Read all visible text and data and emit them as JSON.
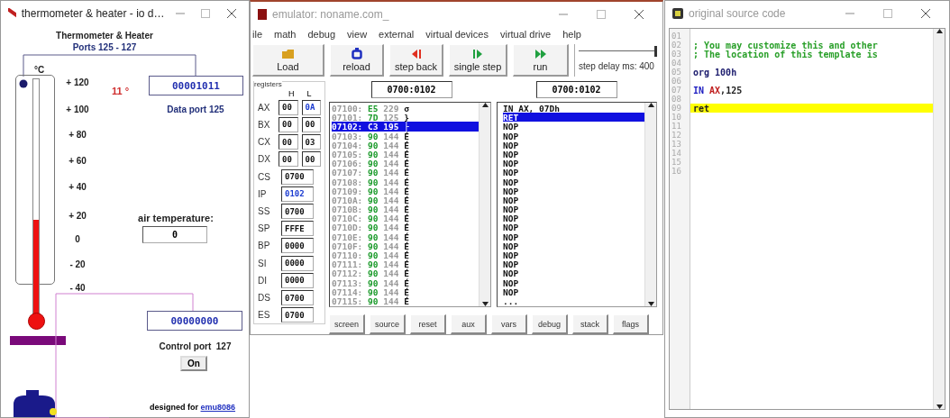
{
  "device": {
    "title": "thermometer & heater - io d…",
    "heading": "Thermometer & Heater",
    "ports": "Ports 125 - 127",
    "unit": "°C",
    "scale": [
      "+ 120",
      "+ 100",
      "+ 80",
      "+ 60",
      "+ 40",
      "+ 20",
      "0",
      "- 20",
      "- 40"
    ],
    "temperature": {
      "reading": "11 °",
      "level": 0.4
    },
    "data_port": {
      "value": "00001011",
      "label": "Data port 125"
    },
    "air": {
      "label": "air temperature:",
      "value": "0"
    },
    "control_port": {
      "value": "00000000",
      "label": "Control port  127"
    },
    "on_button": "On",
    "footer": "designed for",
    "footer_link": "emu8086"
  },
  "emulator": {
    "title": "emulator: noname.com_",
    "menu": [
      "ile",
      "math",
      "debug",
      "view",
      "external",
      "virtual devices",
      "virtual drive",
      "help"
    ],
    "toolbar": [
      {
        "label": "Load",
        "kind": "load"
      },
      {
        "label": "reload",
        "kind": "reload"
      },
      {
        "label": "step back",
        "kind": "back"
      },
      {
        "label": "single step",
        "kind": "step"
      },
      {
        "label": "run",
        "kind": "run"
      }
    ],
    "delay": {
      "label": "step delay ms: 400",
      "level": 1
    },
    "registers": {
      "title": "registers",
      "high": "H",
      "low": "L",
      "pairs": [
        {
          "name": "AX",
          "high": {
            "value": "00",
            "changed": false
          },
          "low": {
            "value": "0A",
            "changed": true
          }
        },
        {
          "name": "BX",
          "high": {
            "value": "00",
            "changed": false
          },
          "low": {
            "value": "00",
            "changed": false
          }
        },
        {
          "name": "CX",
          "high": {
            "value": "00",
            "changed": false
          },
          "low": {
            "value": "03",
            "changed": false
          }
        },
        {
          "name": "DX",
          "high": {
            "value": "00",
            "changed": false
          },
          "low": {
            "value": "00",
            "changed": false
          }
        }
      ],
      "segments": [
        {
          "name": "CS",
          "value": "0700",
          "changed": false
        },
        {
          "name": "IP",
          "value": "0102",
          "changed": true
        },
        {
          "name": "SS",
          "value": "0700",
          "changed": false
        },
        {
          "name": "SP",
          "value": "FFFE",
          "changed": false
        },
        {
          "name": "BP",
          "value": "0000",
          "changed": false
        },
        {
          "name": "SI",
          "value": "0000",
          "changed": false
        },
        {
          "name": "DI",
          "value": "0000",
          "changed": false
        },
        {
          "name": "DS",
          "value": "0700",
          "changed": false
        },
        {
          "name": "ES",
          "value": "0700",
          "changed": false
        }
      ]
    },
    "memory_address": "0700:0102",
    "disasm_address": "0700:0102",
    "memory": [
      {
        "addr": "07100:",
        "hex": "E5",
        "dec": "229",
        "char": "σ",
        "selected": false
      },
      {
        "addr": "07101:",
        "hex": "7D",
        "dec": "125",
        "char": "}",
        "selected": false
      },
      {
        "addr": "07102:",
        "hex": "C3",
        "dec": "195",
        "char": "├",
        "selected": true
      },
      {
        "addr": "07103:",
        "hex": "90",
        "dec": "144",
        "char": "É",
        "selected": false
      },
      {
        "addr": "07104:",
        "hex": "90",
        "dec": "144",
        "char": "É",
        "selected": false
      },
      {
        "addr": "07105:",
        "hex": "90",
        "dec": "144",
        "char": "É",
        "selected": false
      },
      {
        "addr": "07106:",
        "hex": "90",
        "dec": "144",
        "char": "É",
        "selected": false
      },
      {
        "addr": "07107:",
        "hex": "90",
        "dec": "144",
        "char": "É",
        "selected": false
      },
      {
        "addr": "07108:",
        "hex": "90",
        "dec": "144",
        "char": "É",
        "selected": false
      },
      {
        "addr": "07109:",
        "hex": "90",
        "dec": "144",
        "char": "É",
        "selected": false
      },
      {
        "addr": "0710A:",
        "hex": "90",
        "dec": "144",
        "char": "É",
        "selected": false
      },
      {
        "addr": "0710B:",
        "hex": "90",
        "dec": "144",
        "char": "É",
        "selected": false
      },
      {
        "addr": "0710C:",
        "hex": "90",
        "dec": "144",
        "char": "É",
        "selected": false
      },
      {
        "addr": "0710D:",
        "hex": "90",
        "dec": "144",
        "char": "É",
        "selected": false
      },
      {
        "addr": "0710E:",
        "hex": "90",
        "dec": "144",
        "char": "É",
        "selected": false
      },
      {
        "addr": "0710F:",
        "hex": "90",
        "dec": "144",
        "char": "É",
        "selected": false
      },
      {
        "addr": "07110:",
        "hex": "90",
        "dec": "144",
        "char": "É",
        "selected": false
      },
      {
        "addr": "07111:",
        "hex": "90",
        "dec": "144",
        "char": "É",
        "selected": false
      },
      {
        "addr": "07112:",
        "hex": "90",
        "dec": "144",
        "char": "É",
        "selected": false
      },
      {
        "addr": "07113:",
        "hex": "90",
        "dec": "144",
        "char": "É",
        "selected": false
      },
      {
        "addr": "07114:",
        "hex": "90",
        "dec": "144",
        "char": "É",
        "selected": false
      },
      {
        "addr": "07115:",
        "hex": "90",
        "dec": "144",
        "char": "É",
        "selected": false
      }
    ],
    "disasm": [
      {
        "text": "IN AX, 07Dh",
        "selected": false
      },
      {
        "text": "RET",
        "selected": true
      },
      {
        "text": "NOP",
        "selected": false
      },
      {
        "text": "NOP",
        "selected": false
      },
      {
        "text": "NOP",
        "selected": false
      },
      {
        "text": "NOP",
        "selected": false
      },
      {
        "text": "NOP",
        "selected": false
      },
      {
        "text": "NOP",
        "selected": false
      },
      {
        "text": "NOP",
        "selected": false
      },
      {
        "text": "NOP",
        "selected": false
      },
      {
        "text": "NOP",
        "selected": false
      },
      {
        "text": "NOP",
        "selected": false
      },
      {
        "text": "NOP",
        "selected": false
      },
      {
        "text": "NOP",
        "selected": false
      },
      {
        "text": "NOP",
        "selected": false
      },
      {
        "text": "NOP",
        "selected": false
      },
      {
        "text": "NOP",
        "selected": false
      },
      {
        "text": "NOP",
        "selected": false
      },
      {
        "text": "NOP",
        "selected": false
      },
      {
        "text": "NOP",
        "selected": false
      },
      {
        "text": "NOP",
        "selected": false
      },
      {
        "text": "...",
        "selected": false
      }
    ],
    "buttons": [
      "screen",
      "source",
      "reset",
      "aux",
      "vars",
      "debug",
      "stack",
      "flags"
    ]
  },
  "source": {
    "title": "original source code",
    "lines": [
      {
        "number": "01",
        "highlighted": false
      },
      {
        "number": "02",
        "highlighted": false,
        "tokens": [
          {
            "text": "; You may customize this and other",
            "kind": "comment"
          }
        ]
      },
      {
        "number": "03",
        "highlighted": false,
        "tokens": [
          {
            "text": "; The location of this template is",
            "kind": "comment"
          }
        ]
      },
      {
        "number": "04",
        "highlighted": false
      },
      {
        "number": "05",
        "highlighted": false,
        "tokens": [
          {
            "text": "org 100h",
            "kind": "directive"
          }
        ]
      },
      {
        "number": "06",
        "highlighted": false
      },
      {
        "number": "07",
        "highlighted": false,
        "tokens": [
          {
            "text": "IN",
            "kind": "instruction"
          },
          {
            "text": " AX",
            "kind": "register"
          },
          {
            "text": ",125",
            "kind": "plain"
          }
        ]
      },
      {
        "number": "08",
        "highlighted": false
      },
      {
        "number": "09",
        "highlighted": true,
        "tokens": [
          {
            "text": "ret",
            "kind": "plain"
          }
        ]
      },
      {
        "number": "10",
        "highlighted": false
      },
      {
        "number": "11",
        "highlighted": false
      },
      {
        "number": "12",
        "highlighted": false
      },
      {
        "number": "13",
        "highlighted": false
      },
      {
        "number": "14",
        "highlighted": false
      },
      {
        "number": "15",
        "highlighted": false
      },
      {
        "number": "16",
        "highlighted": false
      }
    ]
  }
}
